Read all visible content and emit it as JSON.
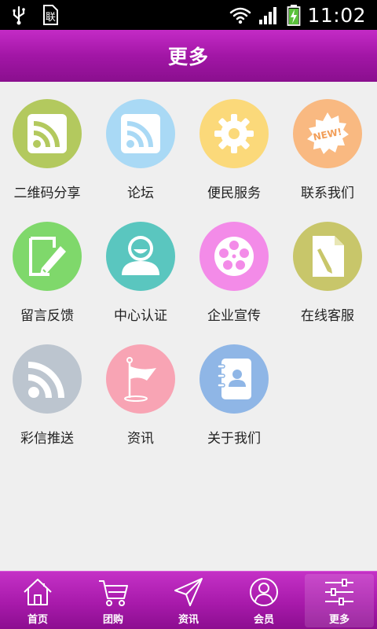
{
  "status_bar": {
    "time": "11:02",
    "sim_glyph": "联",
    "icons": [
      "usb-icon",
      "sim-icon",
      "wifi-icon",
      "signal-icon",
      "battery-charging-icon"
    ]
  },
  "header": {
    "title": "更多"
  },
  "tiles": [
    {
      "label": "二维码分享",
      "icon": "rss-icon",
      "color": "#b3c95e"
    },
    {
      "label": "论坛",
      "icon": "rss-icon",
      "color": "#a9d9f5"
    },
    {
      "label": "便民服务",
      "icon": "gear-icon",
      "color": "#fbd97a"
    },
    {
      "label": "联系我们",
      "icon": "new-badge-icon",
      "color": "#f9b981"
    },
    {
      "label": "留言反馈",
      "icon": "edit-note-icon",
      "color": "#7fd86b"
    },
    {
      "label": "中心认证",
      "icon": "user-icon",
      "color": "#5ac6bf"
    },
    {
      "label": "企业宣传",
      "icon": "film-reel-icon",
      "color": "#f38be8"
    },
    {
      "label": "在线客服",
      "icon": "document-edit-icon",
      "color": "#c8c66a"
    },
    {
      "label": "彩信推送",
      "icon": "rss-icon",
      "color": "#bcc5cf"
    },
    {
      "label": "资讯",
      "icon": "flag-icon",
      "color": "#f8a4b4"
    },
    {
      "label": "关于我们",
      "icon": "contact-book-icon",
      "color": "#8fb6e6"
    }
  ],
  "bottom_nav": [
    {
      "label": "首页",
      "icon": "home-icon",
      "active": false
    },
    {
      "label": "团购",
      "icon": "cart-icon",
      "active": false
    },
    {
      "label": "资讯",
      "icon": "send-icon",
      "active": false
    },
    {
      "label": "会员",
      "icon": "member-icon",
      "active": false
    },
    {
      "label": "更多",
      "icon": "settings-sliders-icon",
      "active": true
    }
  ],
  "colors": {
    "accent": "#a216a6",
    "background": "#efefef"
  }
}
